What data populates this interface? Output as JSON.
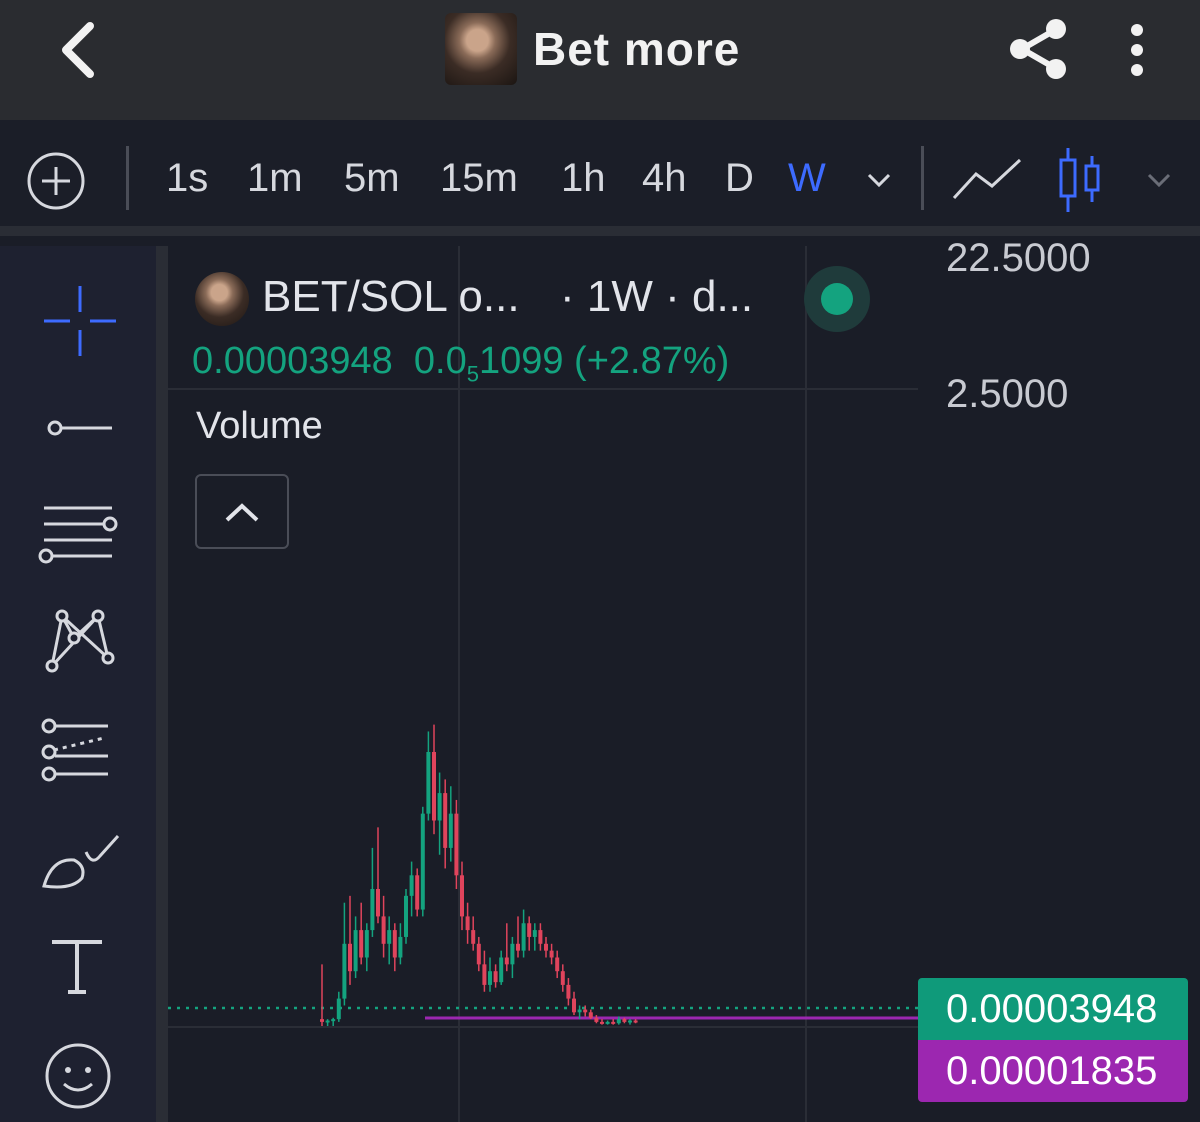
{
  "header": {
    "title": "Bet more",
    "icons": {
      "back": "chevron-left-icon",
      "share": "share-icon",
      "menu": "kebab-menu-icon"
    }
  },
  "toolbar": {
    "timeframes": [
      "1s",
      "1m",
      "5m",
      "15m",
      "1h",
      "4h",
      "D",
      "W"
    ],
    "active_timeframe": "W",
    "accent_color": "#3d6bff"
  },
  "drawing_tools": [
    "crosshair-icon",
    "trend-line-icon",
    "horizontal-lines-icon",
    "pattern-icon",
    "projection-icon",
    "brush-icon",
    "text-icon",
    "emoji-icon"
  ],
  "legend": {
    "pair": "BET/SOL o...",
    "interval": "· 1W · d...",
    "price": "0.00003948",
    "change_main": "0.0",
    "change_sub": "5",
    "change_rest": "1099 (+2.87%)",
    "volume_label": "Volume",
    "up_color": "#14a37f"
  },
  "price_axis": {
    "ticks": [
      "22.5000",
      "2.5000"
    ],
    "last_price": "0.00003948",
    "ref_price": "0.00001835",
    "last_color": "#0f9a7a",
    "ref_color": "#9c27b0"
  },
  "chart_data": {
    "type": "candlestick",
    "symbol": "BET/SOL",
    "interval": "1W",
    "y_ticks": [
      22.5,
      2.5
    ],
    "last_price": 3.948e-05,
    "reference_line": 1.835e-05,
    "up_color": "#14a37f",
    "down_color": "#e0445c",
    "candles": [
      {
        "o": 0.5,
        "h": 4.5,
        "l": 0.0,
        "c": 0.3
      },
      {
        "o": 0.3,
        "h": 0.5,
        "l": 0.0,
        "c": 0.4
      },
      {
        "o": 0.4,
        "h": 0.6,
        "l": 0.0,
        "c": 0.5
      },
      {
        "o": 0.5,
        "h": 2.5,
        "l": 0.3,
        "c": 2.0
      },
      {
        "o": 2.0,
        "h": 9.0,
        "l": 1.5,
        "c": 6.0
      },
      {
        "o": 6.0,
        "h": 9.5,
        "l": 3.0,
        "c": 4.0
      },
      {
        "o": 4.0,
        "h": 8.0,
        "l": 3.5,
        "c": 7.0
      },
      {
        "o": 7.0,
        "h": 9.0,
        "l": 4.5,
        "c": 5.0
      },
      {
        "o": 5.0,
        "h": 7.5,
        "l": 4.0,
        "c": 7.0
      },
      {
        "o": 7.0,
        "h": 13.0,
        "l": 6.5,
        "c": 10.0
      },
      {
        "o": 10.0,
        "h": 14.5,
        "l": 7.5,
        "c": 8.0
      },
      {
        "o": 8.0,
        "h": 9.5,
        "l": 5.0,
        "c": 6.0
      },
      {
        "o": 6.0,
        "h": 8.0,
        "l": 4.5,
        "c": 7.0
      },
      {
        "o": 7.0,
        "h": 7.5,
        "l": 4.0,
        "c": 5.0
      },
      {
        "o": 5.0,
        "h": 7.5,
        "l": 4.5,
        "c": 6.5
      },
      {
        "o": 6.5,
        "h": 10.0,
        "l": 6.0,
        "c": 9.5
      },
      {
        "o": 9.5,
        "h": 12.0,
        "l": 8.0,
        "c": 11.0
      },
      {
        "o": 11.0,
        "h": 11.5,
        "l": 8.0,
        "c": 8.5
      },
      {
        "o": 8.5,
        "h": 16.0,
        "l": 8.0,
        "c": 15.5
      },
      {
        "o": 15.5,
        "h": 21.5,
        "l": 15.0,
        "c": 20.0
      },
      {
        "o": 20.0,
        "h": 22.0,
        "l": 14.0,
        "c": 15.0
      },
      {
        "o": 15.0,
        "h": 18.5,
        "l": 12.5,
        "c": 17.0
      },
      {
        "o": 17.0,
        "h": 18.0,
        "l": 11.5,
        "c": 13.0
      },
      {
        "o": 13.0,
        "h": 17.5,
        "l": 12.0,
        "c": 15.5
      },
      {
        "o": 15.5,
        "h": 16.5,
        "l": 10.0,
        "c": 11.0
      },
      {
        "o": 11.0,
        "h": 12.0,
        "l": 7.0,
        "c": 8.0
      },
      {
        "o": 8.0,
        "h": 9.0,
        "l": 6.0,
        "c": 7.0
      },
      {
        "o": 7.0,
        "h": 8.0,
        "l": 5.5,
        "c": 6.0
      },
      {
        "o": 6.0,
        "h": 6.5,
        "l": 4.0,
        "c": 4.5
      },
      {
        "o": 4.5,
        "h": 5.5,
        "l": 2.5,
        "c": 3.0
      },
      {
        "o": 3.0,
        "h": 5.0,
        "l": 2.5,
        "c": 4.0
      },
      {
        "o": 4.0,
        "h": 4.5,
        "l": 2.8,
        "c": 3.2
      },
      {
        "o": 3.2,
        "h": 5.5,
        "l": 3.0,
        "c": 5.0
      },
      {
        "o": 5.0,
        "h": 7.5,
        "l": 4.0,
        "c": 4.5
      },
      {
        "o": 4.5,
        "h": 6.5,
        "l": 3.5,
        "c": 6.0
      },
      {
        "o": 6.0,
        "h": 8.0,
        "l": 5.0,
        "c": 5.5
      },
      {
        "o": 5.5,
        "h": 8.5,
        "l": 5.0,
        "c": 7.5
      },
      {
        "o": 7.5,
        "h": 8.0,
        "l": 5.5,
        "c": 6.5
      },
      {
        "o": 6.5,
        "h": 7.5,
        "l": 5.5,
        "c": 7.0
      },
      {
        "o": 7.0,
        "h": 7.5,
        "l": 5.5,
        "c": 6.0
      },
      {
        "o": 6.0,
        "h": 6.5,
        "l": 5.0,
        "c": 5.5
      },
      {
        "o": 5.5,
        "h": 6.0,
        "l": 4.5,
        "c": 5.0
      },
      {
        "o": 5.0,
        "h": 5.5,
        "l": 3.5,
        "c": 4.0
      },
      {
        "o": 4.0,
        "h": 4.5,
        "l": 2.5,
        "c": 3.0
      },
      {
        "o": 3.0,
        "h": 3.5,
        "l": 1.5,
        "c": 2.0
      },
      {
        "o": 2.0,
        "h": 2.5,
        "l": 0.8,
        "c": 1.0
      },
      {
        "o": 1.0,
        "h": 1.5,
        "l": 0.5,
        "c": 1.2
      },
      {
        "o": 1.2,
        "h": 1.5,
        "l": 0.7,
        "c": 1.0
      },
      {
        "o": 1.0,
        "h": 1.2,
        "l": 0.5,
        "c": 0.6
      },
      {
        "o": 0.6,
        "h": 0.8,
        "l": 0.2,
        "c": 0.3
      },
      {
        "o": 0.3,
        "h": 0.5,
        "l": 0.1,
        "c": 0.2
      },
      {
        "o": 0.2,
        "h": 0.4,
        "l": 0.1,
        "c": 0.3
      },
      {
        "o": 0.3,
        "h": 0.5,
        "l": 0.1,
        "c": 0.2
      },
      {
        "o": 0.2,
        "h": 0.7,
        "l": 0.1,
        "c": 0.5
      },
      {
        "o": 0.5,
        "h": 0.6,
        "l": 0.2,
        "c": 0.3
      },
      {
        "o": 0.3,
        "h": 0.5,
        "l": 0.1,
        "c": 0.4
      },
      {
        "o": 0.4,
        "h": 0.5,
        "l": 0.2,
        "c": 0.3
      }
    ]
  }
}
